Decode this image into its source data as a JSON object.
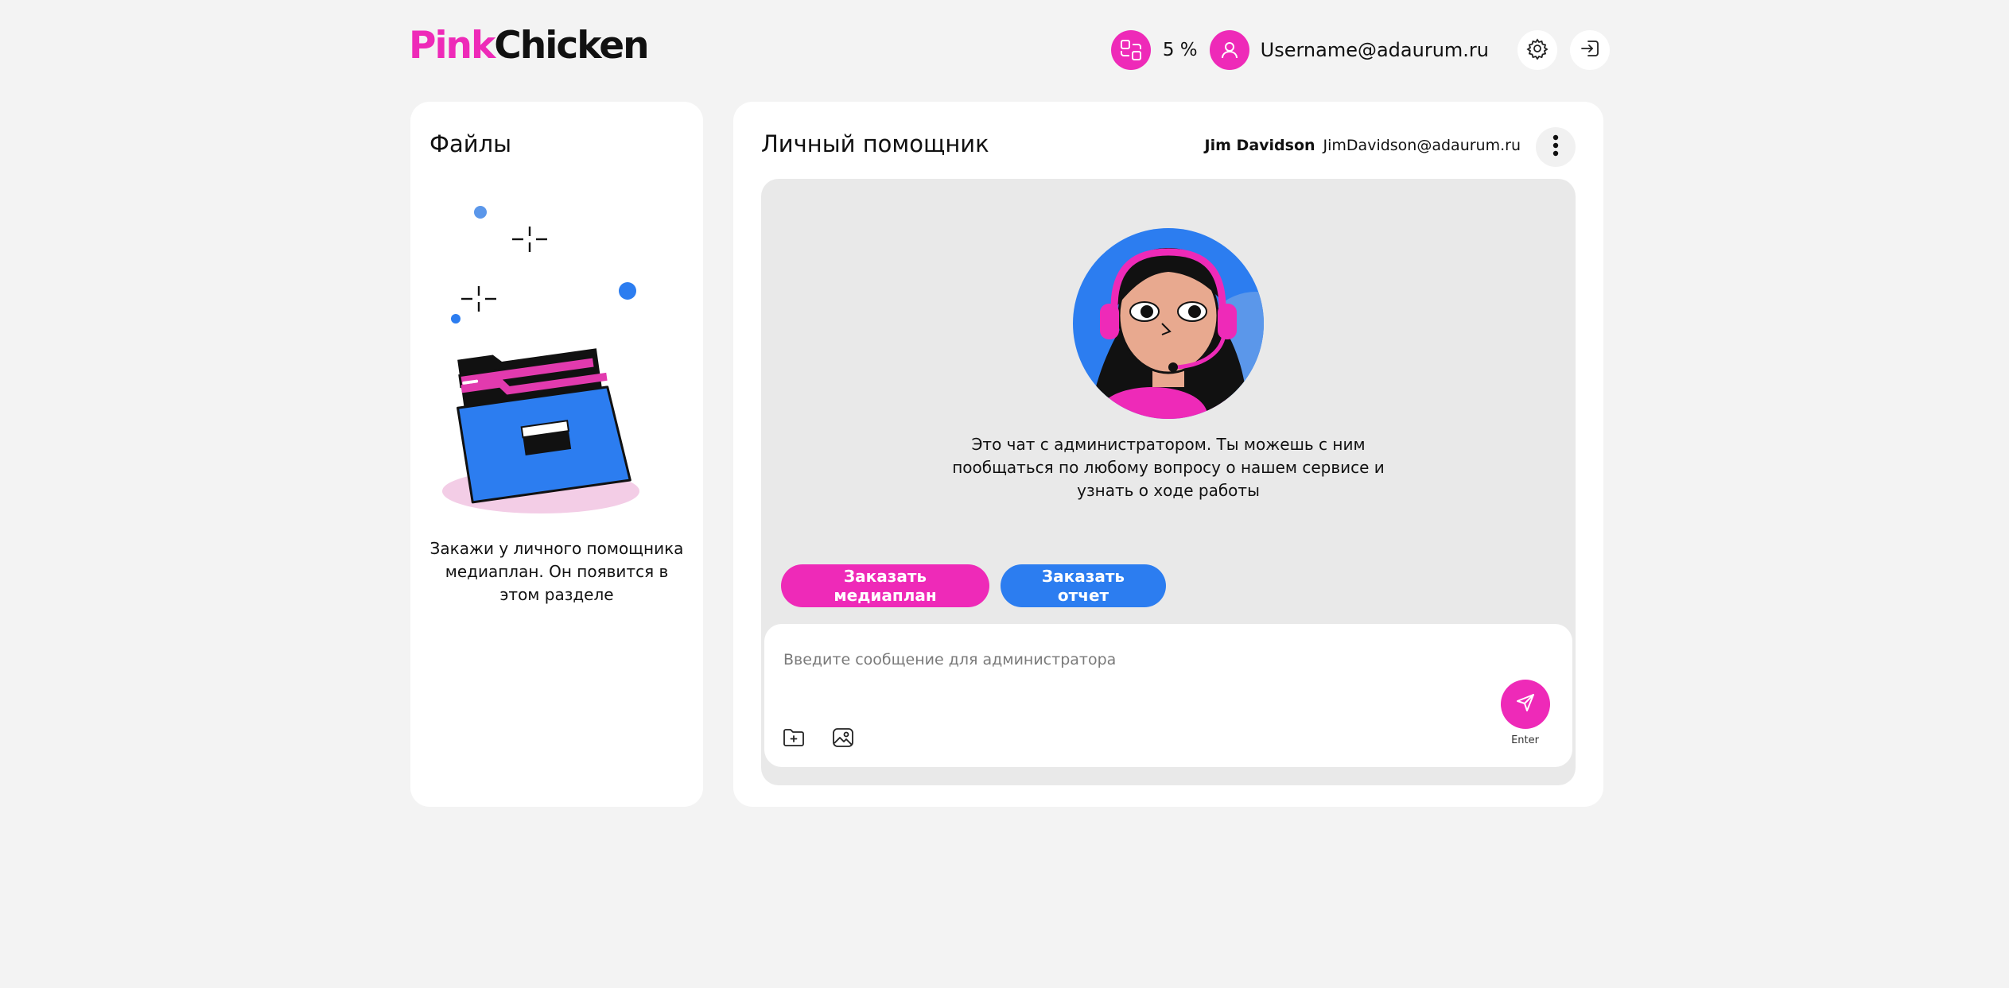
{
  "header": {
    "logo_part1": "Pink",
    "logo_part2": "Chicken",
    "progress_percent": "5 %",
    "username": "Username@adaurum.ru",
    "icons": [
      "progress-icon",
      "user-icon",
      "gear-icon",
      "logout-icon"
    ]
  },
  "files": {
    "title": "Файлы",
    "hint": "Закажи у личного помощника медиаплан. Он появится в этом разделе",
    "illustration": "folder-icon"
  },
  "chat": {
    "title": "Личный помощник",
    "contact_name": "Jim Davidson",
    "contact_email": "JimDavidson@adaurum.ru",
    "intro": "Это чат с администратором. Ты можешь с ним пообщаться по любому вопросу о нашем сервисе и узнать о ходе работы",
    "buttons": {
      "order_mediaplan": "Заказать медиаплан",
      "order_report": "Заказать отчет"
    },
    "input_placeholder": "Введите сообщение для администратора",
    "input_value": "",
    "send_hint": "Enter",
    "icons": [
      "more-icon",
      "attach-folder-icon",
      "attach-image-icon",
      "send-icon"
    ]
  },
  "colors": {
    "brand_pink": "#ee2ab8",
    "brand_blue": "#2c7df0",
    "background": "#f3f3f3",
    "chat_area": "#e9e9e9"
  }
}
